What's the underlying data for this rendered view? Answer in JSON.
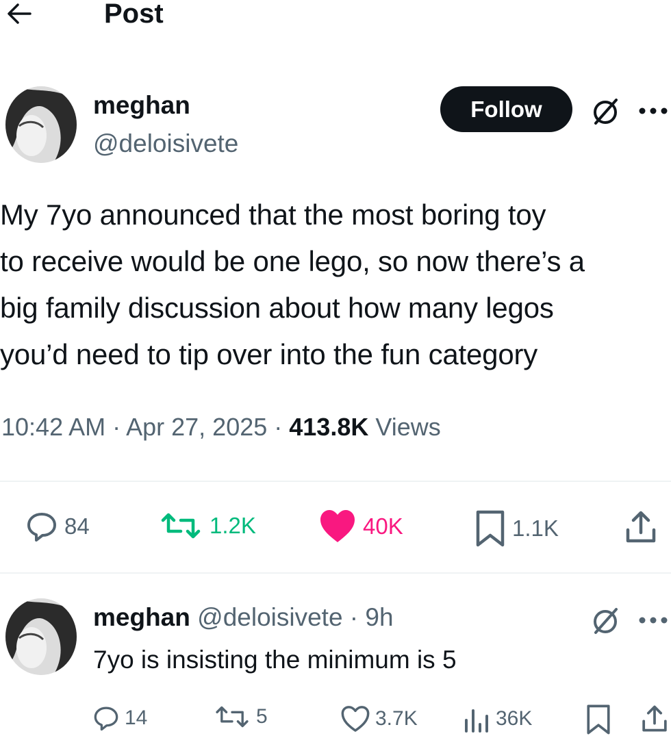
{
  "header": {
    "title": "Post"
  },
  "author": {
    "name": "meghan",
    "handle": "@deloisivete"
  },
  "follow_label": "Follow",
  "tweet": {
    "text": "My 7yo announced that the most boring toy\nto receive would be one lego, so now there’s a\nbig family discussion about how many legos\nyou’d need to tip over into the fun category",
    "time": "10:42 AM · Apr 27, 2025 · ",
    "views_count": "413.8K",
    "views_label": " Views"
  },
  "actions": {
    "replies": "84",
    "reposts": "1.2K",
    "likes": "40K",
    "bookmarks": "1.1K"
  },
  "reply": {
    "name": "meghan",
    "handle_time": "@deloisivete · 9h",
    "text": "7yo is insisting the minimum is 5",
    "replies": "14",
    "reposts": "5",
    "likes": "3.7K",
    "views": "36K"
  },
  "colors": {
    "text": "#0f1419",
    "secondary": "#536471",
    "repost_green": "#00ba7c",
    "like_pink": "#f91880",
    "divider": "#eff3f4"
  },
  "icons": [
    "back-arrow-icon",
    "grok-icon",
    "more-icon",
    "reply-icon",
    "repost-icon",
    "heart-icon",
    "bookmark-icon",
    "share-icon",
    "views-icon"
  ]
}
